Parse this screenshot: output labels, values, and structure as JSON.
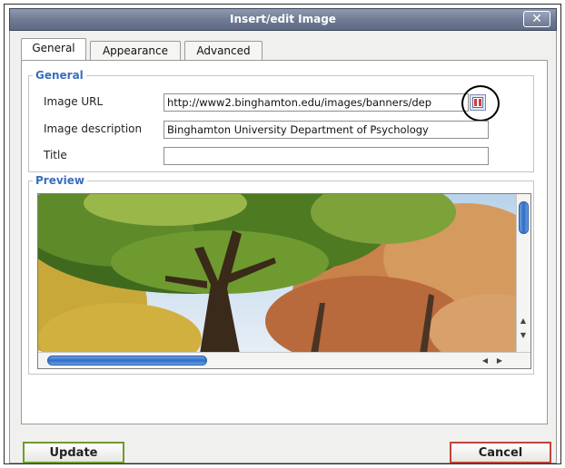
{
  "dialog": {
    "title": "Insert/edit Image",
    "close_label": "✕"
  },
  "tabs": [
    {
      "label": "General",
      "active": true
    },
    {
      "label": "Appearance",
      "active": false
    },
    {
      "label": "Advanced",
      "active": false
    }
  ],
  "general": {
    "legend": "General",
    "image_url_label": "Image URL",
    "image_url_value": "http://www2.binghamton.edu/images/banners/dep",
    "image_description_label": "Image description",
    "image_description_value": "Binghamton University Department of Psychology",
    "title_label": "Title",
    "title_value": ""
  },
  "preview": {
    "legend": "Preview",
    "image_description": "Binghamton University Department of Psychology"
  },
  "buttons": {
    "update": "Update",
    "cancel": "Cancel"
  },
  "colors": {
    "title_bar": "#6f7b94",
    "legend": "#3a6ebd",
    "scroll_thumb": "#2e6cc8",
    "update_border": "#6f9a2e",
    "cancel_border": "#c0453a"
  },
  "icons": {
    "browse": "file-browser-icon",
    "close": "close-icon"
  }
}
